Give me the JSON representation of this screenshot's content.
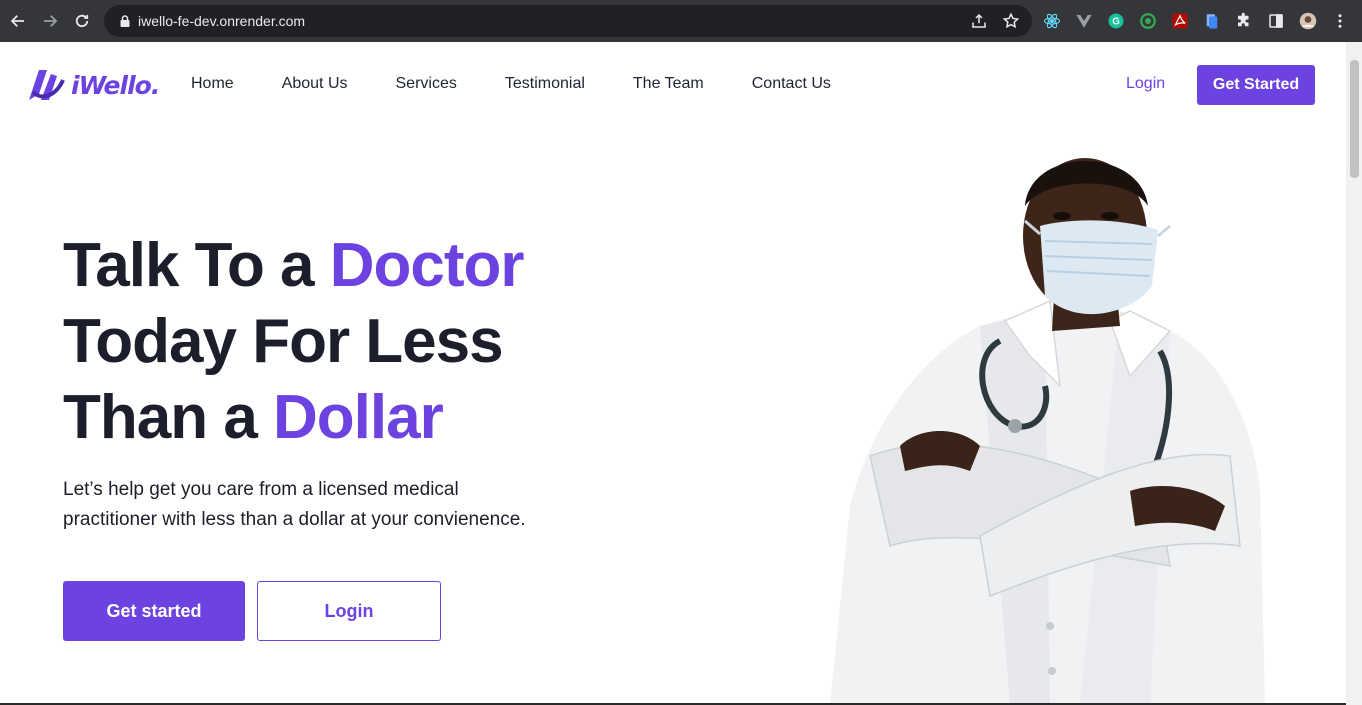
{
  "browser": {
    "url": "iwello-fe-dev.onrender.com",
    "icons": [
      "back-arrow-icon",
      "forward-arrow-icon",
      "reload-icon",
      "lock-icon",
      "share-icon",
      "star-icon",
      "react-devtools-icon",
      "vue-icon",
      "grammarly-icon",
      "extension-green-icon",
      "acrobat-icon",
      "docs-icon",
      "puzzle-icon",
      "sidepanel-icon",
      "profile-avatar",
      "kebab-menu-icon"
    ]
  },
  "site": {
    "logo_text": "iWello.",
    "brand_color": "#6c42e0",
    "nav": [
      "Home",
      "About Us",
      "Services",
      "Testimonial",
      "The Team",
      "Contact Us"
    ],
    "login": "Login",
    "get_started": "Get Started"
  },
  "hero": {
    "line1_a": "Talk To a ",
    "line1_b": "Doctor",
    "line2": "Today For Less",
    "line3_a": "Than a ",
    "line3_b": "Dollar",
    "subtitle": "Let’s help get you care from a licensed medical practitioner with less than a dollar at your convienence.",
    "primary_btn": "Get started",
    "secondary_btn": "Login"
  }
}
